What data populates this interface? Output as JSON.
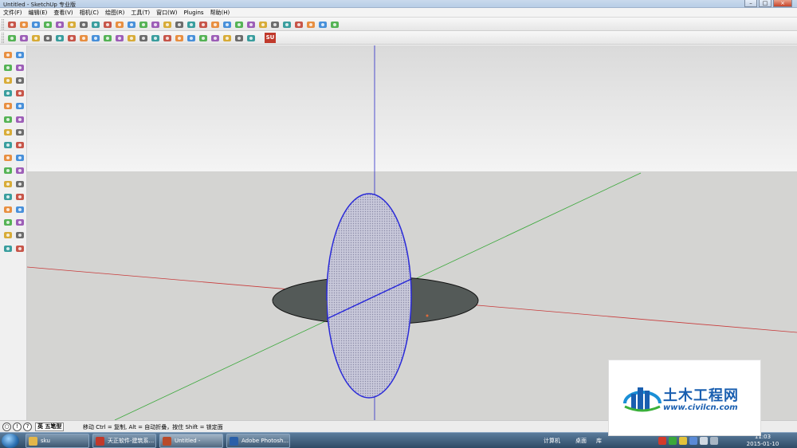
{
  "window": {
    "title": "Untitled - SketchUp 专业版",
    "controls": [
      "–",
      "□",
      "×"
    ]
  },
  "menu": [
    "文件(F)",
    "编辑(E)",
    "查看(V)",
    "相机(C)",
    "绘图(R)",
    "工具(T)",
    "窗口(W)",
    "Plugins",
    "帮助(H)"
  ],
  "toolbar_icons": {
    "row1": [
      "select-icon",
      "pencil-icon",
      "line-icon",
      "rectangle-icon",
      "circle-icon",
      "arc-icon",
      "make-component-icon",
      "eraser-icon",
      "tape-measure-icon",
      "paint-bucket-icon",
      "push-pull-icon",
      "move-icon",
      "rotate-icon",
      "follow-me-icon",
      "scale-icon",
      "offset-icon",
      "orbit-icon",
      "pan-icon",
      "zoom-icon",
      "zoom-extents-icon",
      "iso-view-icon",
      "top-view-icon",
      "front-view-icon",
      "right-view-icon",
      "back-view-icon",
      "left-view-icon",
      "get-models-icon",
      "share-model-icon"
    ],
    "row2": [
      "plugin-tool-icon"
    ],
    "su_badge": "SU"
  },
  "left_tools": [
    "select-icon",
    "make-component-icon",
    "paint-bucket-icon",
    "eraser-icon",
    "rectangle-icon",
    "line-icon",
    "circle-icon",
    "arc-icon",
    "polygon-icon",
    "freehand-icon",
    "move-icon",
    "push-pull-icon",
    "rotate-icon",
    "follow-me-icon",
    "scale-icon",
    "offset-icon",
    "tape-measure-icon",
    "dimension-icon",
    "protractor-icon",
    "text-icon",
    "axes-icon",
    "3d-text-icon",
    "orbit-icon",
    "pan-icon",
    "zoom-icon",
    "zoom-window-icon",
    "zoom-extents-icon",
    "previous-view-icon",
    "position-camera-icon",
    "look-around-icon",
    "walk-icon",
    "section-plane-icon"
  ],
  "status": {
    "box_label": "英 五笔型",
    "message": "移动 Ctrl = 复制, Alt = 自动折叠，按住 Shift = 锁定面"
  },
  "taskbar": {
    "tasks": [
      {
        "label": "sku",
        "color": "#e2b64a"
      },
      {
        "label": "天正软件-建筑系...",
        "color": "#c0392b"
      },
      {
        "label": "Untitled - Sketc...",
        "color": "#b84a2a"
      },
      {
        "label": "Adobe Photosh...",
        "color": "#2a5fa8"
      }
    ],
    "tray_text_1": "计算机",
    "tray_text_2": "桌面",
    "tray_text_3": "库",
    "time": "11:03",
    "date": "2015-01-10"
  },
  "watermark": {
    "title": "土木工程网",
    "url": "www.civilcn.com"
  },
  "colors": {
    "sky": "#eeeeee",
    "ground": "#d4d4d2",
    "axis_red": "#c83a3a",
    "axis_green": "#3aa83a",
    "axis_blue": "#2a2ac8",
    "vertical_face": "#b8b8cc",
    "horizontal_face": "#545a58"
  }
}
